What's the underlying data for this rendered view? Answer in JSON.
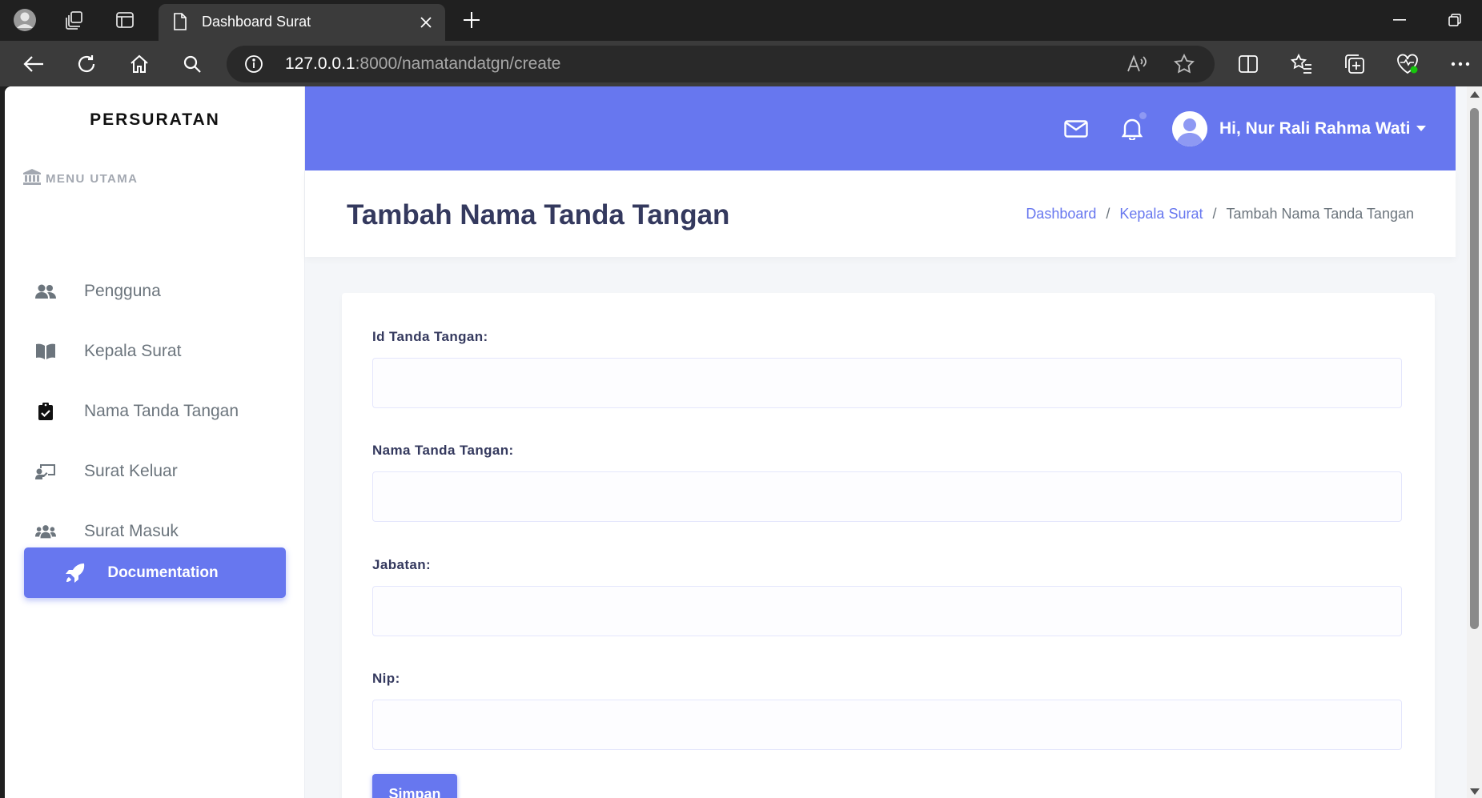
{
  "browser": {
    "tab_title": "Dashboard Surat",
    "url_host": "127.0.0.1",
    "url_rest": ":8000/namatandatgn/create"
  },
  "sidebar": {
    "brand": "PERSURATAN",
    "menu_header": "MENU UTAMA",
    "items": [
      {
        "label": "Pengguna",
        "icon": "users-icon"
      },
      {
        "label": "Kepala Surat",
        "icon": "book-icon"
      },
      {
        "label": "Nama Tanda Tangan",
        "icon": "clipboard-check-icon"
      },
      {
        "label": "Surat Keluar",
        "icon": "chalkboard-teacher-icon"
      },
      {
        "label": "Surat Masuk",
        "icon": "users-group-icon"
      }
    ],
    "doc_button": "Documentation"
  },
  "navbar": {
    "user_greeting": "Hi, Nur Rali Rahma Wati"
  },
  "header": {
    "title": "Tambah Nama Tanda Tangan",
    "breadcrumb": [
      "Dashboard",
      "Kepala Surat",
      "Tambah Nama Tanda Tangan"
    ],
    "breadcrumb_sep": "/"
  },
  "form": {
    "fields": [
      {
        "label": "Id Tanda Tangan:",
        "value": ""
      },
      {
        "label": "Nama Tanda Tangan:",
        "value": ""
      },
      {
        "label": "Jabatan:",
        "value": ""
      },
      {
        "label": "Nip:",
        "value": ""
      }
    ],
    "submit_label": "Simpan"
  },
  "colors": {
    "primary": "#6777ef",
    "title": "#34395e",
    "muted": "#6c757d"
  }
}
